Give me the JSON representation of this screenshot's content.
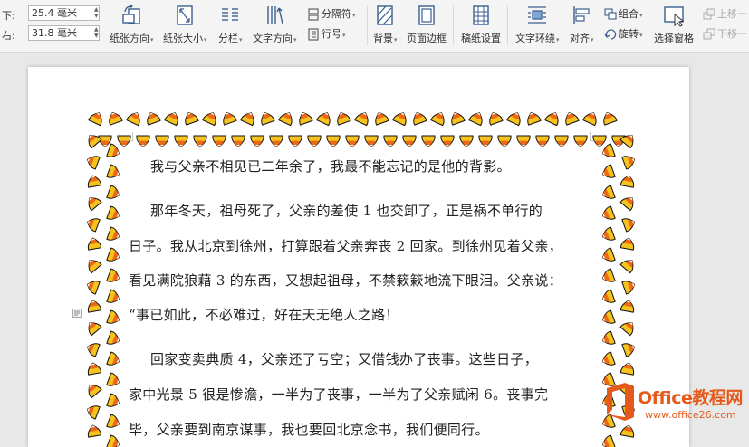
{
  "ribbon": {
    "margin_bottom": {
      "label": "下:",
      "value": "25.4 毫米"
    },
    "margin_right": {
      "label": "右:",
      "value": "31.8 毫米"
    },
    "tools": {
      "orientation": "纸张方向",
      "size": "纸张大小",
      "columns": "分栏",
      "text_direction": "文字方向",
      "separator": "分隔符",
      "line_number": "行号",
      "background": "背景",
      "page_border": "页面边框",
      "manuscript": "稿纸设置",
      "text_wrap": "文字环绕",
      "align": "对齐",
      "group": "组合",
      "rotate": "旋转",
      "selection_pane": "选择窗格",
      "bring_forward": "上移一",
      "send_backward": "下移一"
    }
  },
  "document": {
    "lines": [
      "我与父亲不相见已二年余了，我最不能忘记的是他的背影。",
      "那年冬天，祖母死了，父亲的差使 1 也交卸了，正是祸不单行的",
      "日子。我从北京到徐州，打算跟着父亲奔丧 2 回家。到徐州见着父亲，",
      "看见满院狼藉 3 的东西，又想起祖母，不禁簌簌地流下眼泪。父亲说：",
      "“事已如此，不必难过，好在天无绝人之路！",
      "回家变卖典质 4，父亲还了亏空；又借钱办了丧事。这些日子，",
      "家中光景 5 很是惨澹，一半为了丧事，一半为了父亲赋闲 6。丧事完",
      "毕，父亲要到南京谋事，我也要回北京念书，我们便同行。"
    ]
  },
  "watermark": {
    "title": "Office教程网",
    "url": "www.office26.com"
  },
  "colors": {
    "candy_yellow": "#f6c21d",
    "candy_orange": "#ee6a12",
    "candy_white": "#ffffff",
    "brand_orange": "#e55a1b"
  }
}
